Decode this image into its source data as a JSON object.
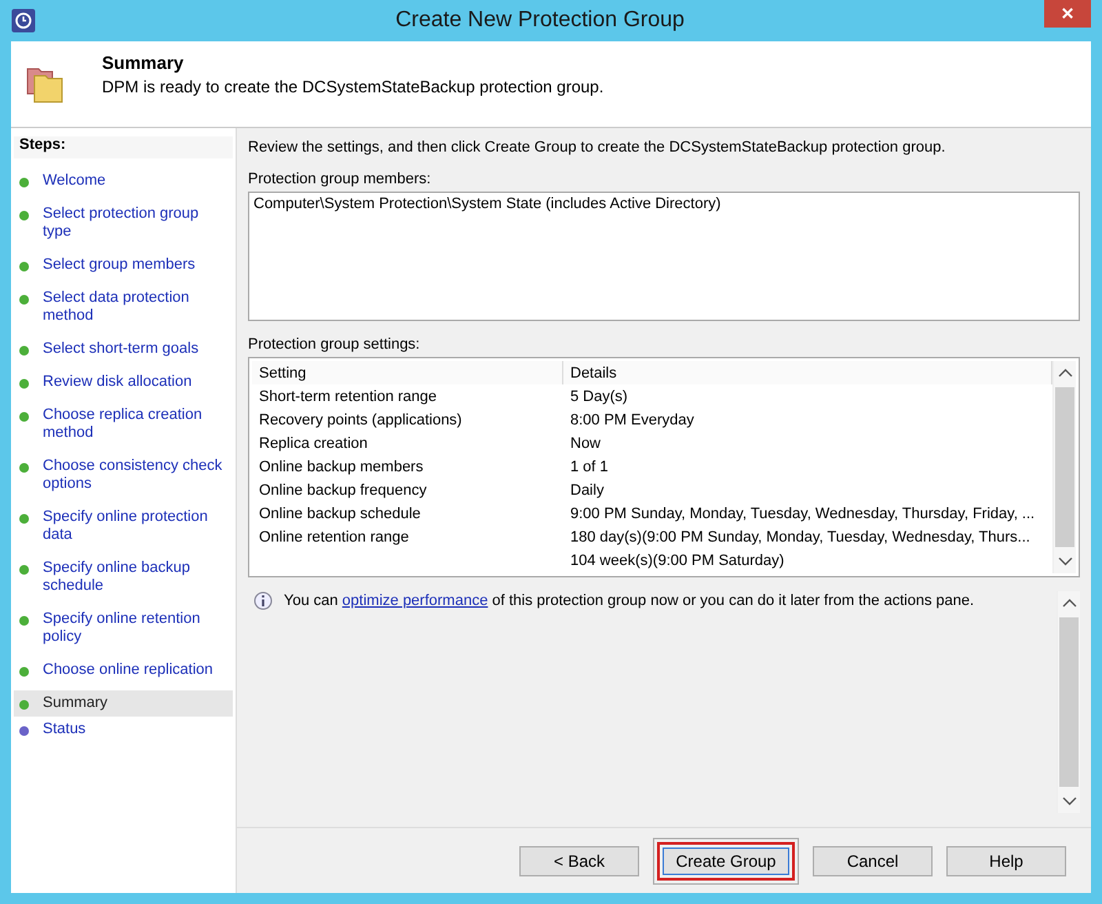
{
  "window": {
    "title": "Create New Protection Group",
    "close_label": "✕"
  },
  "header": {
    "title": "Summary",
    "subtitle": "DPM is ready to create the DCSystemStateBackup protection group."
  },
  "sidebar": {
    "title": "Steps:",
    "items": [
      {
        "label": "Welcome",
        "color": "#4caf3a",
        "selected": false
      },
      {
        "label": "Select protection group type",
        "color": "#4caf3a",
        "selected": false
      },
      {
        "label": "Select group members",
        "color": "#4caf3a",
        "selected": false
      },
      {
        "label": "Select data protection method",
        "color": "#4caf3a",
        "selected": false
      },
      {
        "label": "Select short-term goals",
        "color": "#4caf3a",
        "selected": false
      },
      {
        "label": "Review disk allocation",
        "color": "#4caf3a",
        "selected": false
      },
      {
        "label": "Choose replica creation method",
        "color": "#4caf3a",
        "selected": false
      },
      {
        "label": "Choose consistency check options",
        "color": "#4caf3a",
        "selected": false
      },
      {
        "label": "Specify online protection data",
        "color": "#4caf3a",
        "selected": false
      },
      {
        "label": "Specify online backup schedule",
        "color": "#4caf3a",
        "selected": false
      },
      {
        "label": "Specify online retention policy",
        "color": "#4caf3a",
        "selected": false
      },
      {
        "label": "Choose online replication",
        "color": "#4caf3a",
        "selected": false
      },
      {
        "label": "Summary",
        "color": "#4caf3a",
        "selected": true
      },
      {
        "label": "Status",
        "color": "#6a63c8",
        "selected": false
      }
    ]
  },
  "intro": "Review the settings, and then click Create Group to create the DCSystemStateBackup protection group.",
  "members": {
    "label": "Protection group members:",
    "items": [
      "Computer\\System Protection\\System State (includes Active Directory)"
    ]
  },
  "settings": {
    "label": "Protection group settings:",
    "columns": [
      "Setting",
      "Details"
    ],
    "rows": [
      [
        "Short-term retention range",
        "5 Day(s)"
      ],
      [
        "Recovery points (applications)",
        "8:00 PM Everyday"
      ],
      [
        "Replica creation",
        "Now"
      ],
      [
        "Online backup members",
        "1 of 1"
      ],
      [
        "Online backup frequency",
        "Daily"
      ],
      [
        "Online backup schedule",
        "9:00 PM Sunday, Monday, Tuesday, Wednesday, Thursday, Friday, ..."
      ],
      [
        "Online retention range",
        "180 day(s)(9:00 PM Sunday, Monday, Tuesday, Wednesday, Thurs..."
      ],
      [
        "",
        "104 week(s)(9:00 PM Saturday)"
      ]
    ]
  },
  "info": {
    "before": "You can",
    "link": "optimize performance",
    "after": "of this protection group now or you can do it later from the actions pane."
  },
  "buttons": [
    {
      "label": "< Back",
      "highlighted": false
    },
    {
      "label": "Create Group",
      "highlighted": true
    },
    {
      "label": "Cancel",
      "highlighted": false
    },
    {
      "label": "Help",
      "highlighted": false
    }
  ]
}
